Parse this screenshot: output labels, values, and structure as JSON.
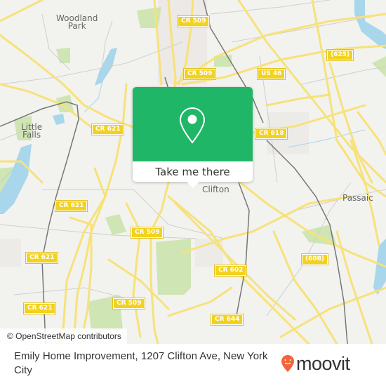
{
  "map": {
    "places": [
      {
        "name": "woodland-park",
        "label": "Woodland\nPark"
      },
      {
        "name": "little-falls",
        "label": "Little\nFalls"
      },
      {
        "name": "clifton",
        "label": "Clifton"
      },
      {
        "name": "passaic",
        "label": "Passaic"
      }
    ],
    "shields": [
      {
        "label": "CR 509"
      },
      {
        "label": "CR 509"
      },
      {
        "label": "US 46"
      },
      {
        "label": "(625)"
      },
      {
        "label": "CR 621"
      },
      {
        "label": "CR 618"
      },
      {
        "label": "CR 621"
      },
      {
        "label": "CR 509"
      },
      {
        "label": "CR 621"
      },
      {
        "label": "CR 602"
      },
      {
        "label": "(608)"
      },
      {
        "label": "CR 621"
      },
      {
        "label": "CR 509"
      },
      {
        "label": "CR 644"
      }
    ],
    "colors": {
      "background": "#f2f2ef",
      "road": "#f7e27a",
      "water": "#a8d6ea",
      "park": "#cfe5b4",
      "rail": "#777777"
    },
    "attribution": "© OpenStreetMap contributors"
  },
  "popup": {
    "pin_icon": "map-pin-icon",
    "button_label": "Take me there",
    "accent": "#1fb767"
  },
  "footer": {
    "title": "Emily Home Improvement, 1207 Clifton Ave, New York City",
    "logo_text": "moovit",
    "logo_color": "#f2643a"
  }
}
